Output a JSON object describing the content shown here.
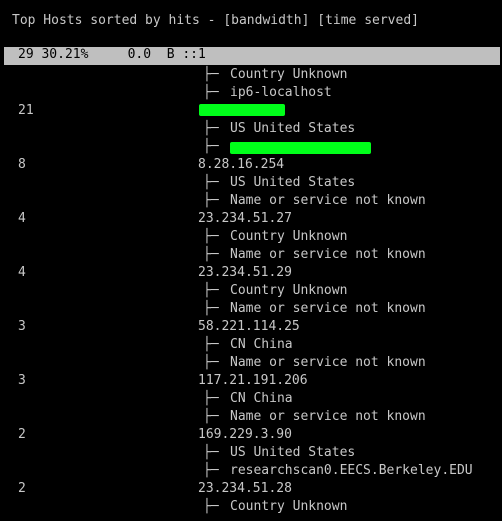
{
  "title": "Top Hosts sorted by hits - [bandwidth] [time served]",
  "header_row": "29 30.21%     0.0  B ::1",
  "branch_glyph": "├─",
  "rows": [
    {
      "count": "",
      "host": "",
      "detail": "Country Unknown"
    },
    {
      "count": "",
      "host": "",
      "detail": "ip6-localhost"
    },
    {
      "count": "21",
      "host": "",
      "detail": ""
    },
    {
      "count": "",
      "host": "",
      "detail": "US United States"
    },
    {
      "count": "",
      "host": "",
      "detail": ""
    },
    {
      "count": "8",
      "host": "8.28.16.254",
      "detail": ""
    },
    {
      "count": "",
      "host": "",
      "detail": "US United States"
    },
    {
      "count": "",
      "host": "",
      "detail": "Name or service not known"
    },
    {
      "count": "4",
      "host": "23.234.51.27",
      "detail": ""
    },
    {
      "count": "",
      "host": "",
      "detail": "Country Unknown"
    },
    {
      "count": "",
      "host": "",
      "detail": "Name or service not known"
    },
    {
      "count": "4",
      "host": "23.234.51.29",
      "detail": ""
    },
    {
      "count": "",
      "host": "",
      "detail": "Country Unknown"
    },
    {
      "count": "",
      "host": "",
      "detail": "Name or service not known"
    },
    {
      "count": "3",
      "host": "58.221.114.25",
      "detail": ""
    },
    {
      "count": "",
      "host": "",
      "detail": "CN China"
    },
    {
      "count": "",
      "host": "",
      "detail": "Name or service not known"
    },
    {
      "count": "3",
      "host": "117.21.191.206",
      "detail": ""
    },
    {
      "count": "",
      "host": "",
      "detail": "CN China"
    },
    {
      "count": "",
      "host": "",
      "detail": "Name or service not known"
    },
    {
      "count": "2",
      "host": "169.229.3.90",
      "detail": ""
    },
    {
      "count": "",
      "host": "",
      "detail": "US United States"
    },
    {
      "count": "",
      "host": "",
      "detail": "researchscan0.EECS.Berkeley.EDU"
    },
    {
      "count": "2",
      "host": "23.234.51.28",
      "detail": ""
    },
    {
      "count": "",
      "host": "",
      "detail": "Country Unknown"
    }
  ],
  "colors": {
    "background": "#000000",
    "text": "#c8c8c8",
    "header_bar": "#bfbfbf",
    "header_text": "#000000",
    "redaction": "#00ff1a"
  }
}
